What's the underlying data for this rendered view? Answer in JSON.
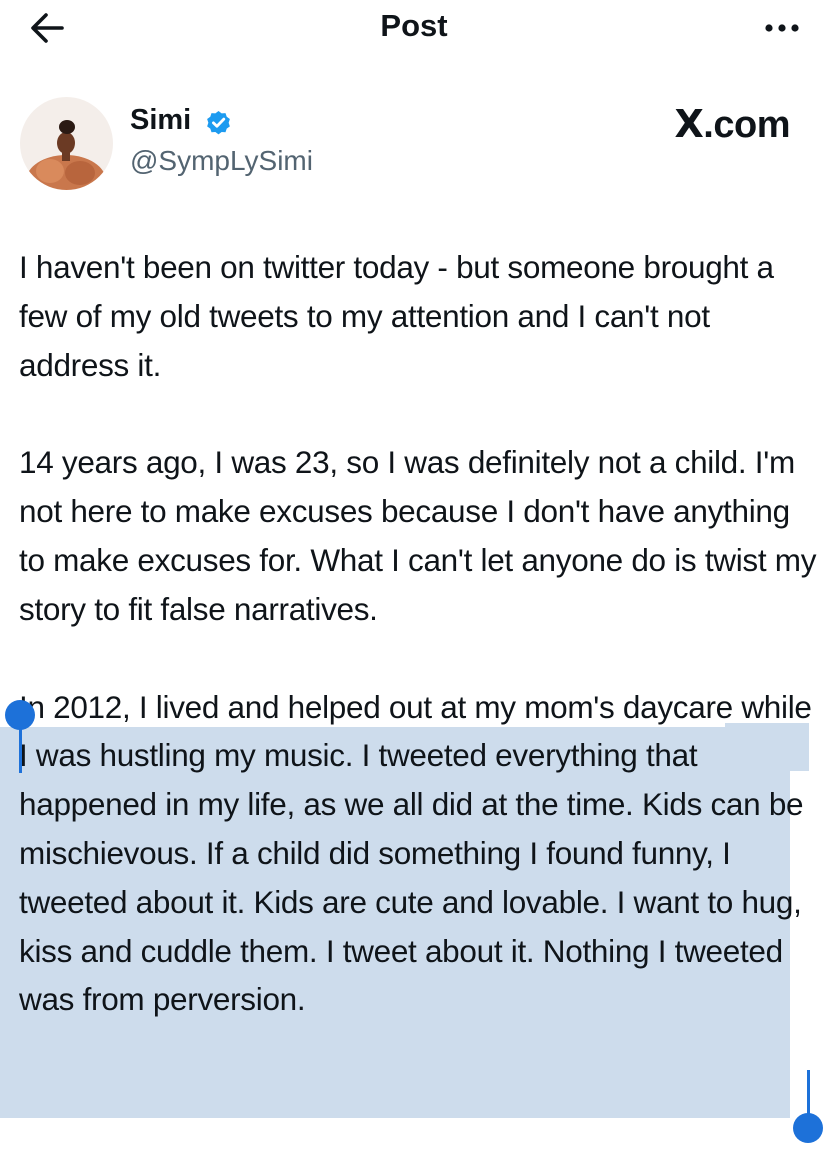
{
  "header": {
    "title": "Post",
    "back_icon": "arrow-left-icon",
    "more_icon": "more-horizontal-icon"
  },
  "author": {
    "name": "Simi",
    "handle": "@SympLySimi",
    "verified_icon": "verified-badge-icon",
    "verified_color": "#1d9bf0"
  },
  "watermark": {
    "text": ".com",
    "logo": "X"
  },
  "tweet": {
    "paragraphs": [
      "I haven't been on twitter today - but someone brought a few of my old tweets to my attention and I can't not address it.",
      "14 years ago, I was 23, so I was definitely not a child. I'm not here to make excuses because I don't have anything to make excuses for. What I can't let anyone do is twist my story to fit false narratives.",
      "In 2012, I lived and helped out at my mom's daycare while I was hustling my music. I tweeted everything that happened in my life, as we all did at the time. Kids can be mischievous. If a child did something I found funny, I tweeted about it. Kids are cute and lovable. I want to hug, kiss and cuddle them. I tweet about it. Nothing I tweeted was from perversion."
    ],
    "selected_paragraph_index": 2
  },
  "colors": {
    "selection": "#cddcec",
    "selection_handle": "#1d71d9",
    "text": "#0f1419",
    "secondary_text": "#536471"
  }
}
